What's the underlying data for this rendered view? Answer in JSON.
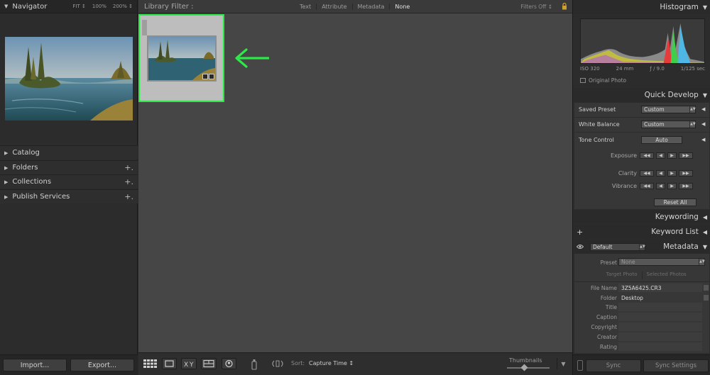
{
  "left_panel": {
    "navigator": {
      "title": "Navigator",
      "zoom_options": [
        "FIT ↕",
        "100%",
        "200% ↕"
      ]
    },
    "items": [
      {
        "label": "Catalog",
        "has_plus": false
      },
      {
        "label": "Folders",
        "has_plus": true
      },
      {
        "label": "Collections",
        "has_plus": true
      },
      {
        "label": "Publish Services",
        "has_plus": true
      }
    ],
    "plus_glyph": "+.",
    "import_label": "Import...",
    "export_label": "Export..."
  },
  "library_filter": {
    "title": "Library Filter :",
    "options": [
      "Text",
      "Attribute",
      "Metadata",
      "None"
    ],
    "selected": "None",
    "filters_off": "Filters Off ↕"
  },
  "grid": {
    "highlight_color": "#2ee84a"
  },
  "toolbar": {
    "sort_label": "Sort:",
    "sort_value": "Capture Time ↕",
    "thumbnails_label": "Thumbnails"
  },
  "right_panel": {
    "histogram": {
      "title": "Histogram",
      "iso": "ISO 320",
      "focal_length": "24 mm",
      "aperture": "ƒ / 9.0",
      "shutter": "1/125 sec",
      "original_photo_label": "Original Photo"
    },
    "quick_develop": {
      "title": "Quick Develop",
      "saved_preset_label": "Saved Preset",
      "saved_preset_value": "Custom",
      "white_balance_label": "White Balance",
      "white_balance_value": "Custom",
      "tone_control_label": "Tone Control",
      "auto_label": "Auto",
      "exposure_label": "Exposure",
      "clarity_label": "Clarity",
      "vibrance_label": "Vibrance",
      "reset_all_label": "Reset All"
    },
    "keywording_title": "Keywording",
    "keyword_list_title": "Keyword List",
    "metadata": {
      "title": "Metadata",
      "view_preset": "Default",
      "preset_label": "Preset",
      "preset_value": "None",
      "target_photo": "Target Photo",
      "selected_photos": "Selected Photos",
      "file_name_label": "File Name",
      "file_name": "3Z5A6425.CR3",
      "folder_label": "Folder",
      "folder": "Desktop",
      "fields": [
        "Title",
        "Caption",
        "Copyright",
        "Creator",
        "Rating"
      ]
    },
    "sync_label": "Sync",
    "sync_settings_label": "Sync Settings"
  }
}
